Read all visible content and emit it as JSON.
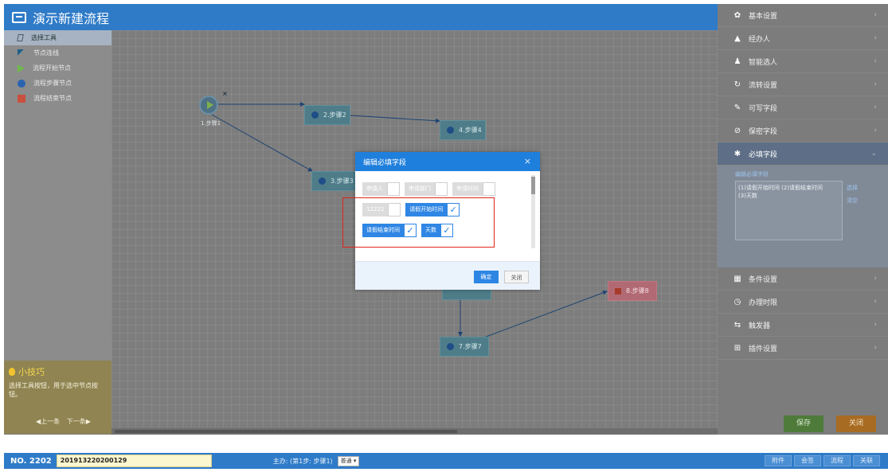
{
  "title": "演示新建流程",
  "tools": [
    {
      "label": "选择工具",
      "icon": "pointer-icon"
    },
    {
      "label": "节点连线",
      "icon": "link-icon"
    },
    {
      "label": "流程开始节点",
      "icon": "start-triangle-icon"
    },
    {
      "label": "流程步骤节点",
      "icon": "step-circle-icon"
    },
    {
      "label": "流程结束节点",
      "icon": "end-square-icon"
    }
  ],
  "tips": {
    "title": "小技巧",
    "text": "选择工具按钮，用于选中节点按钮。",
    "prev": "◀上一条",
    "next": "下一条▶"
  },
  "nodes": {
    "start_label": "1.步骤1",
    "start_close": "×",
    "step2": "2.步骤2",
    "step3": "3.步骤3",
    "step4": "4.步骤4",
    "step7": "7.步骤7",
    "step8": "8.步骤8"
  },
  "settings": [
    {
      "label": "基本设置",
      "icon": "gear-icon"
    },
    {
      "label": "经办人",
      "icon": "user-icon"
    },
    {
      "label": "智能选人",
      "icon": "users-icon"
    },
    {
      "label": "流转设置",
      "icon": "refresh-icon"
    },
    {
      "label": "可写字段",
      "icon": "pencil-icon"
    },
    {
      "label": "保密字段",
      "icon": "eye-slash-icon"
    },
    {
      "label": "必填字段",
      "icon": "asterisk-icon"
    },
    {
      "label": "条件设置",
      "icon": "condition-icon"
    },
    {
      "label": "办理时限",
      "icon": "clock-icon"
    },
    {
      "label": "触发器",
      "icon": "trigger-icon"
    },
    {
      "label": "插件设置",
      "icon": "plugin-icon"
    }
  ],
  "required_panel": {
    "title": "编辑必填字段",
    "line1": "(1)请假开始时间 (2)请假结束时间",
    "line2": "(3)天数",
    "select": "选择",
    "clear": "清空"
  },
  "footer": {
    "save": "保存",
    "close": "关闭"
  },
  "modal": {
    "title": "编辑必填字段",
    "close": "×",
    "fields": [
      {
        "label": "申请人",
        "checked": false
      },
      {
        "label": "申请部门",
        "checked": false
      },
      {
        "label": "申请时间",
        "checked": false
      },
      {
        "label": "12222",
        "checked": false
      },
      {
        "label": "请假开始时间",
        "checked": true
      },
      {
        "label": "请假结束时间",
        "checked": true
      },
      {
        "label": "天数",
        "checked": true
      }
    ],
    "check_mark": "✓",
    "ok": "确定",
    "cancel": "关闭"
  },
  "bottom": {
    "no_label": "NO. 2202",
    "no_value": "201913220200129",
    "host": "主办: (第1步: 步骤1)",
    "select_value": "普通 ▾",
    "buttons": [
      "附件",
      "会签",
      "流程",
      "关联"
    ]
  },
  "colors": {
    "brand": "#2f7bc8",
    "modal_header": "#1f7fdc",
    "highlight": "#e0241b",
    "save": "#4e7b3a",
    "close": "#a86b22"
  }
}
